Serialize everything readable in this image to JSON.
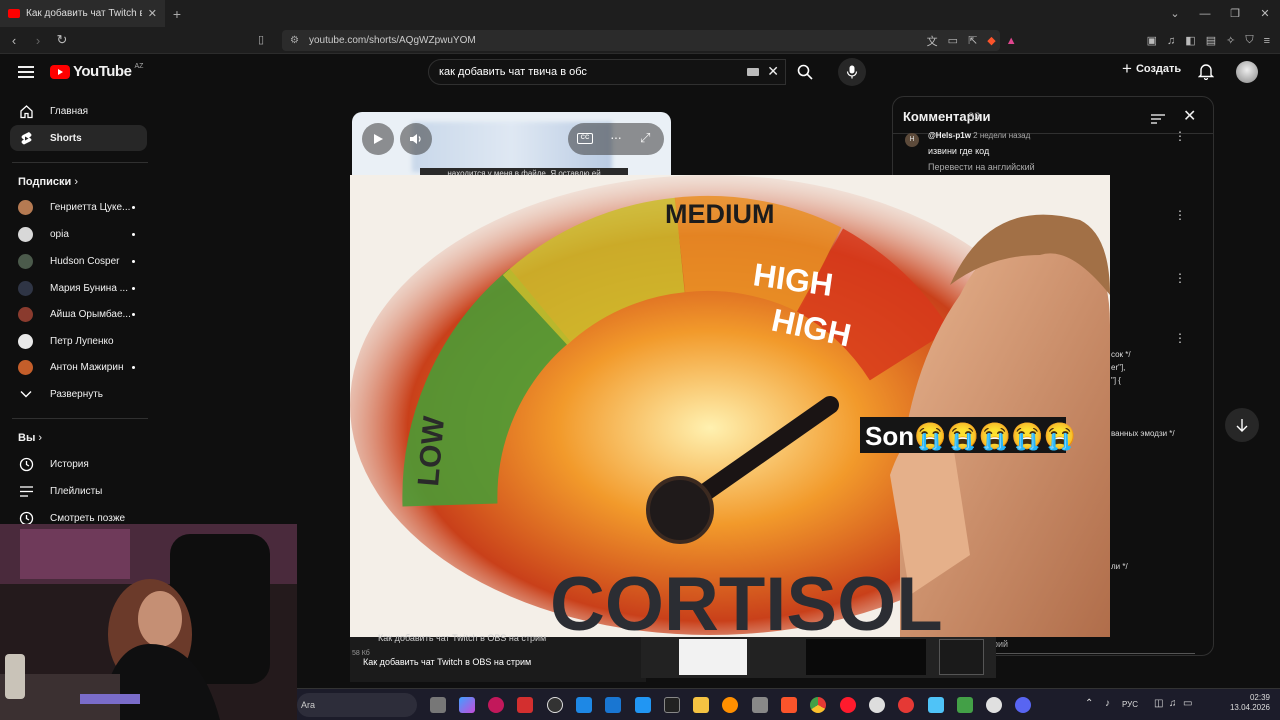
{
  "browser": {
    "tab_title": "Как добавить чат Twitch в OBS",
    "url": "youtube.com/shorts/AQgWZpwuYOM"
  },
  "header": {
    "logo_text": "YouTube",
    "logo_country": "AZ",
    "search_value": "как добавить чат твича в обс",
    "create_label": "Создать"
  },
  "sidebar": {
    "nav": [
      {
        "label": "Главная",
        "icon": "home-icon"
      },
      {
        "label": "Shorts",
        "icon": "shorts-icon"
      }
    ],
    "subs_heading": "Подписки",
    "subscriptions": [
      {
        "name": "Генриетта Цуке...",
        "color": "#b57a52"
      },
      {
        "name": "opia",
        "color": "#d8d8d8"
      },
      {
        "name": "Hudson Cosper",
        "color": "#4b5a4b"
      },
      {
        "name": "Мария Бунина ...",
        "color": "#2f3545"
      },
      {
        "name": "Айша Орымбае...",
        "color": "#8a3b2e"
      },
      {
        "name": "Петр Лупенко",
        "color": "#e9e9e9"
      },
      {
        "name": "Антон Мажирин",
        "color": "#c45e2a"
      }
    ],
    "expand_label": "Развернуть",
    "you_heading": "Вы",
    "you_items": [
      {
        "label": "История",
        "icon": "history-icon"
      },
      {
        "label": "Плейлисты",
        "icon": "playlists-icon"
      },
      {
        "label": "Смотреть позже",
        "icon": "watch-later-icon"
      }
    ]
  },
  "short": {
    "caption": "находится у меня в файле. Я оставлю ей",
    "cc_label": "CC"
  },
  "meme": {
    "medium": "MEDIUM",
    "high1": "HIGH",
    "high2": "HIGH",
    "low": "LOW",
    "caption": "CORTISOL",
    "son": "Son😭😭😭😭😭"
  },
  "comments": {
    "title": "Комментарии",
    "count": "33",
    "first_user": "@Hels-p1w",
    "first_time": "2 недели назад",
    "first_text": "извини где код",
    "translate": "Перевести на английский",
    "code_lines": [
      "сок */",
      "er\"],",
      "\"] {",
      "ванных эмодзи */",
      "ли */"
    ],
    "add_placeholder": "нтарий"
  },
  "bottom": {
    "title_small": "Как добавить чат Twitch в OBS на стрим",
    "title": "Как добавить чат Twitch в OBS на стрим",
    "size": "58 Кб"
  },
  "taskbar": {
    "search_text": "Ara",
    "lang": "РУС",
    "time": "02:39",
    "date": "13.04.2026"
  },
  "colors": {
    "brand": "#ff0000",
    "bg": "#0f0f0f"
  }
}
